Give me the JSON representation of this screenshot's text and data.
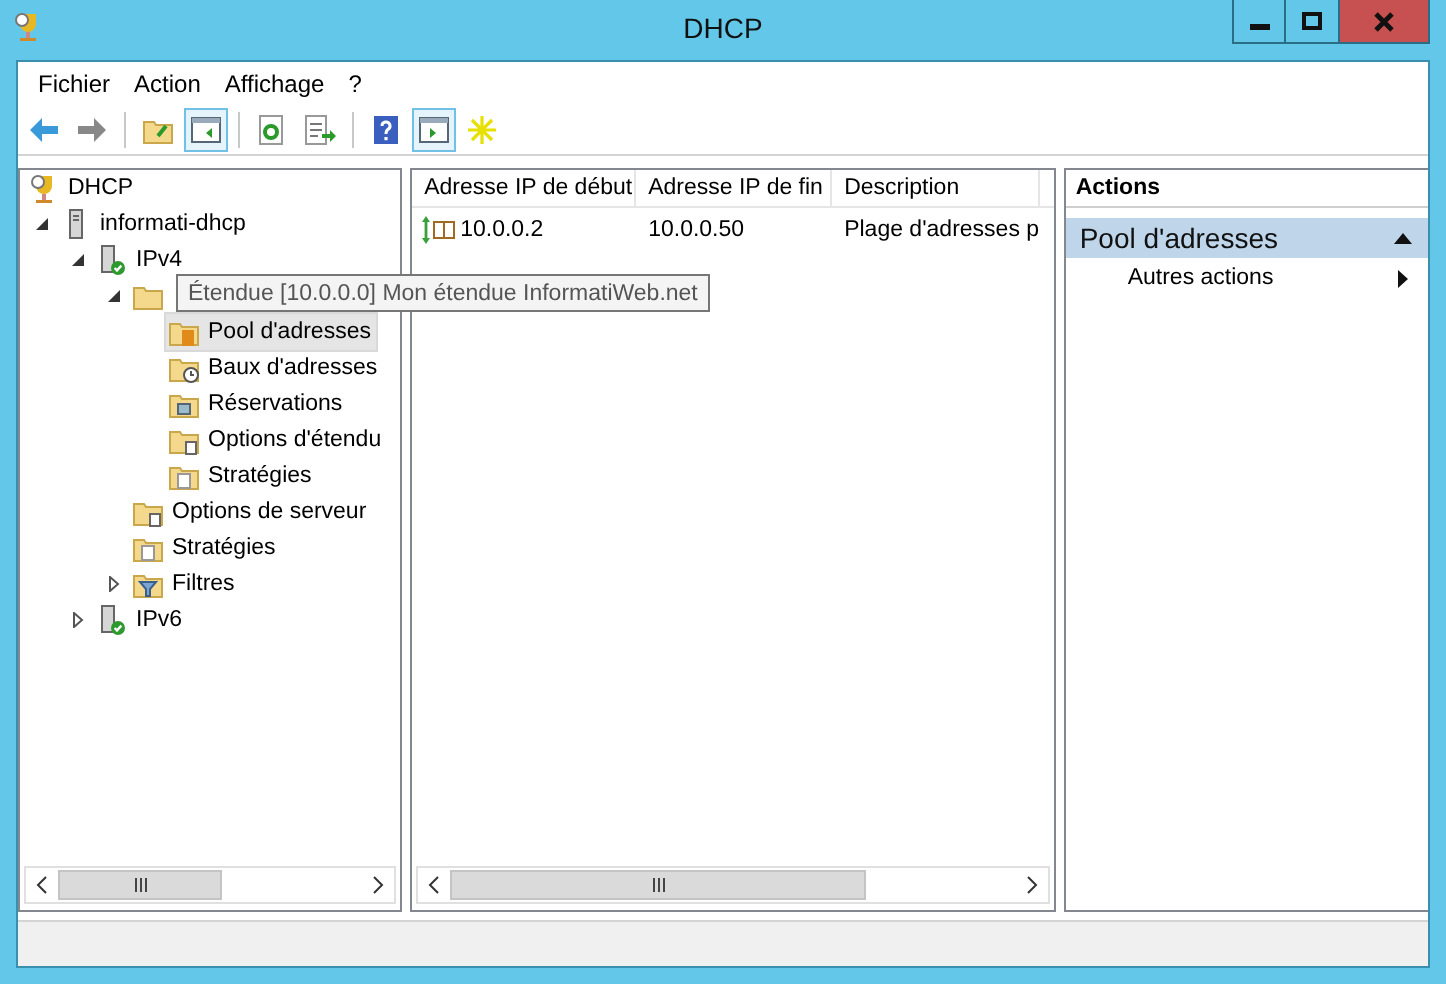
{
  "window": {
    "title": "DHCP"
  },
  "title_buttons": [
    {
      "kind": "minimize"
    },
    {
      "kind": "maximize"
    },
    {
      "kind": "close"
    }
  ],
  "menu": [
    "Fichier",
    "Action",
    "Affichage",
    "?"
  ],
  "toolbar": [
    {
      "kind": "back",
      "pressed": false
    },
    {
      "kind": "forward",
      "pressed": false
    },
    {
      "kind": "up",
      "pressed": false
    },
    {
      "kind": "tree",
      "pressed": true
    },
    {
      "kind": "refresh",
      "pressed": false
    },
    {
      "kind": "export",
      "pressed": false
    },
    {
      "kind": "help",
      "pressed": false
    },
    {
      "kind": "actionpane",
      "pressed": true
    },
    {
      "kind": "star",
      "pressed": false
    }
  ],
  "tree": [
    {
      "label": "DHCP",
      "kind": "root",
      "selected": false,
      "children": [
        {
          "label": "informati-dhcp",
          "kind": "server",
          "expanded": true,
          "selected": false,
          "children": [
            {
              "label": "IPv4",
              "kind": "ip",
              "expanded": true,
              "selected": false,
              "children": [
                {
                  "kind": "folder",
                  "expanded": true,
                  "selected": false,
                  "children": [
                    {
                      "label": "Pool d'adresses",
                      "kind": "pool",
                      "selected": true
                    },
                    {
                      "label": "Baux d'adresses",
                      "kind": "leases",
                      "selected": false
                    },
                    {
                      "label": "Réservations",
                      "kind": "reservations",
                      "selected": false
                    },
                    {
                      "label": "Options d'étendu",
                      "kind": "options",
                      "selected": false
                    },
                    {
                      "label": "Stratégies",
                      "kind": "policies",
                      "selected": false
                    }
                  ]
                },
                {
                  "label": "Options de serveur",
                  "kind": "options",
                  "selected": false
                },
                {
                  "label": "Stratégies",
                  "kind": "policies",
                  "selected": false
                },
                {
                  "label": "Filtres",
                  "kind": "filters",
                  "expanded": false,
                  "selected": false
                }
              ]
            },
            {
              "label": "IPv6",
              "kind": "ip",
              "expanded": false,
              "selected": false
            }
          ]
        }
      ]
    }
  ],
  "tooltip": "Étendue [10.0.0.0] Mon étendue InformatiWeb.net",
  "table": {
    "columns": [
      "Adresse IP de début",
      "Adresse IP de fin",
      "Description"
    ],
    "rows": [
      [
        "10.0.0.2",
        "10.0.0.50",
        "Plage d'adresses p"
      ]
    ]
  },
  "actions": {
    "header": "Actions",
    "section": {
      "title": "Pool d'adresses",
      "expanded": true
    },
    "items": [
      "Autres actions"
    ]
  }
}
